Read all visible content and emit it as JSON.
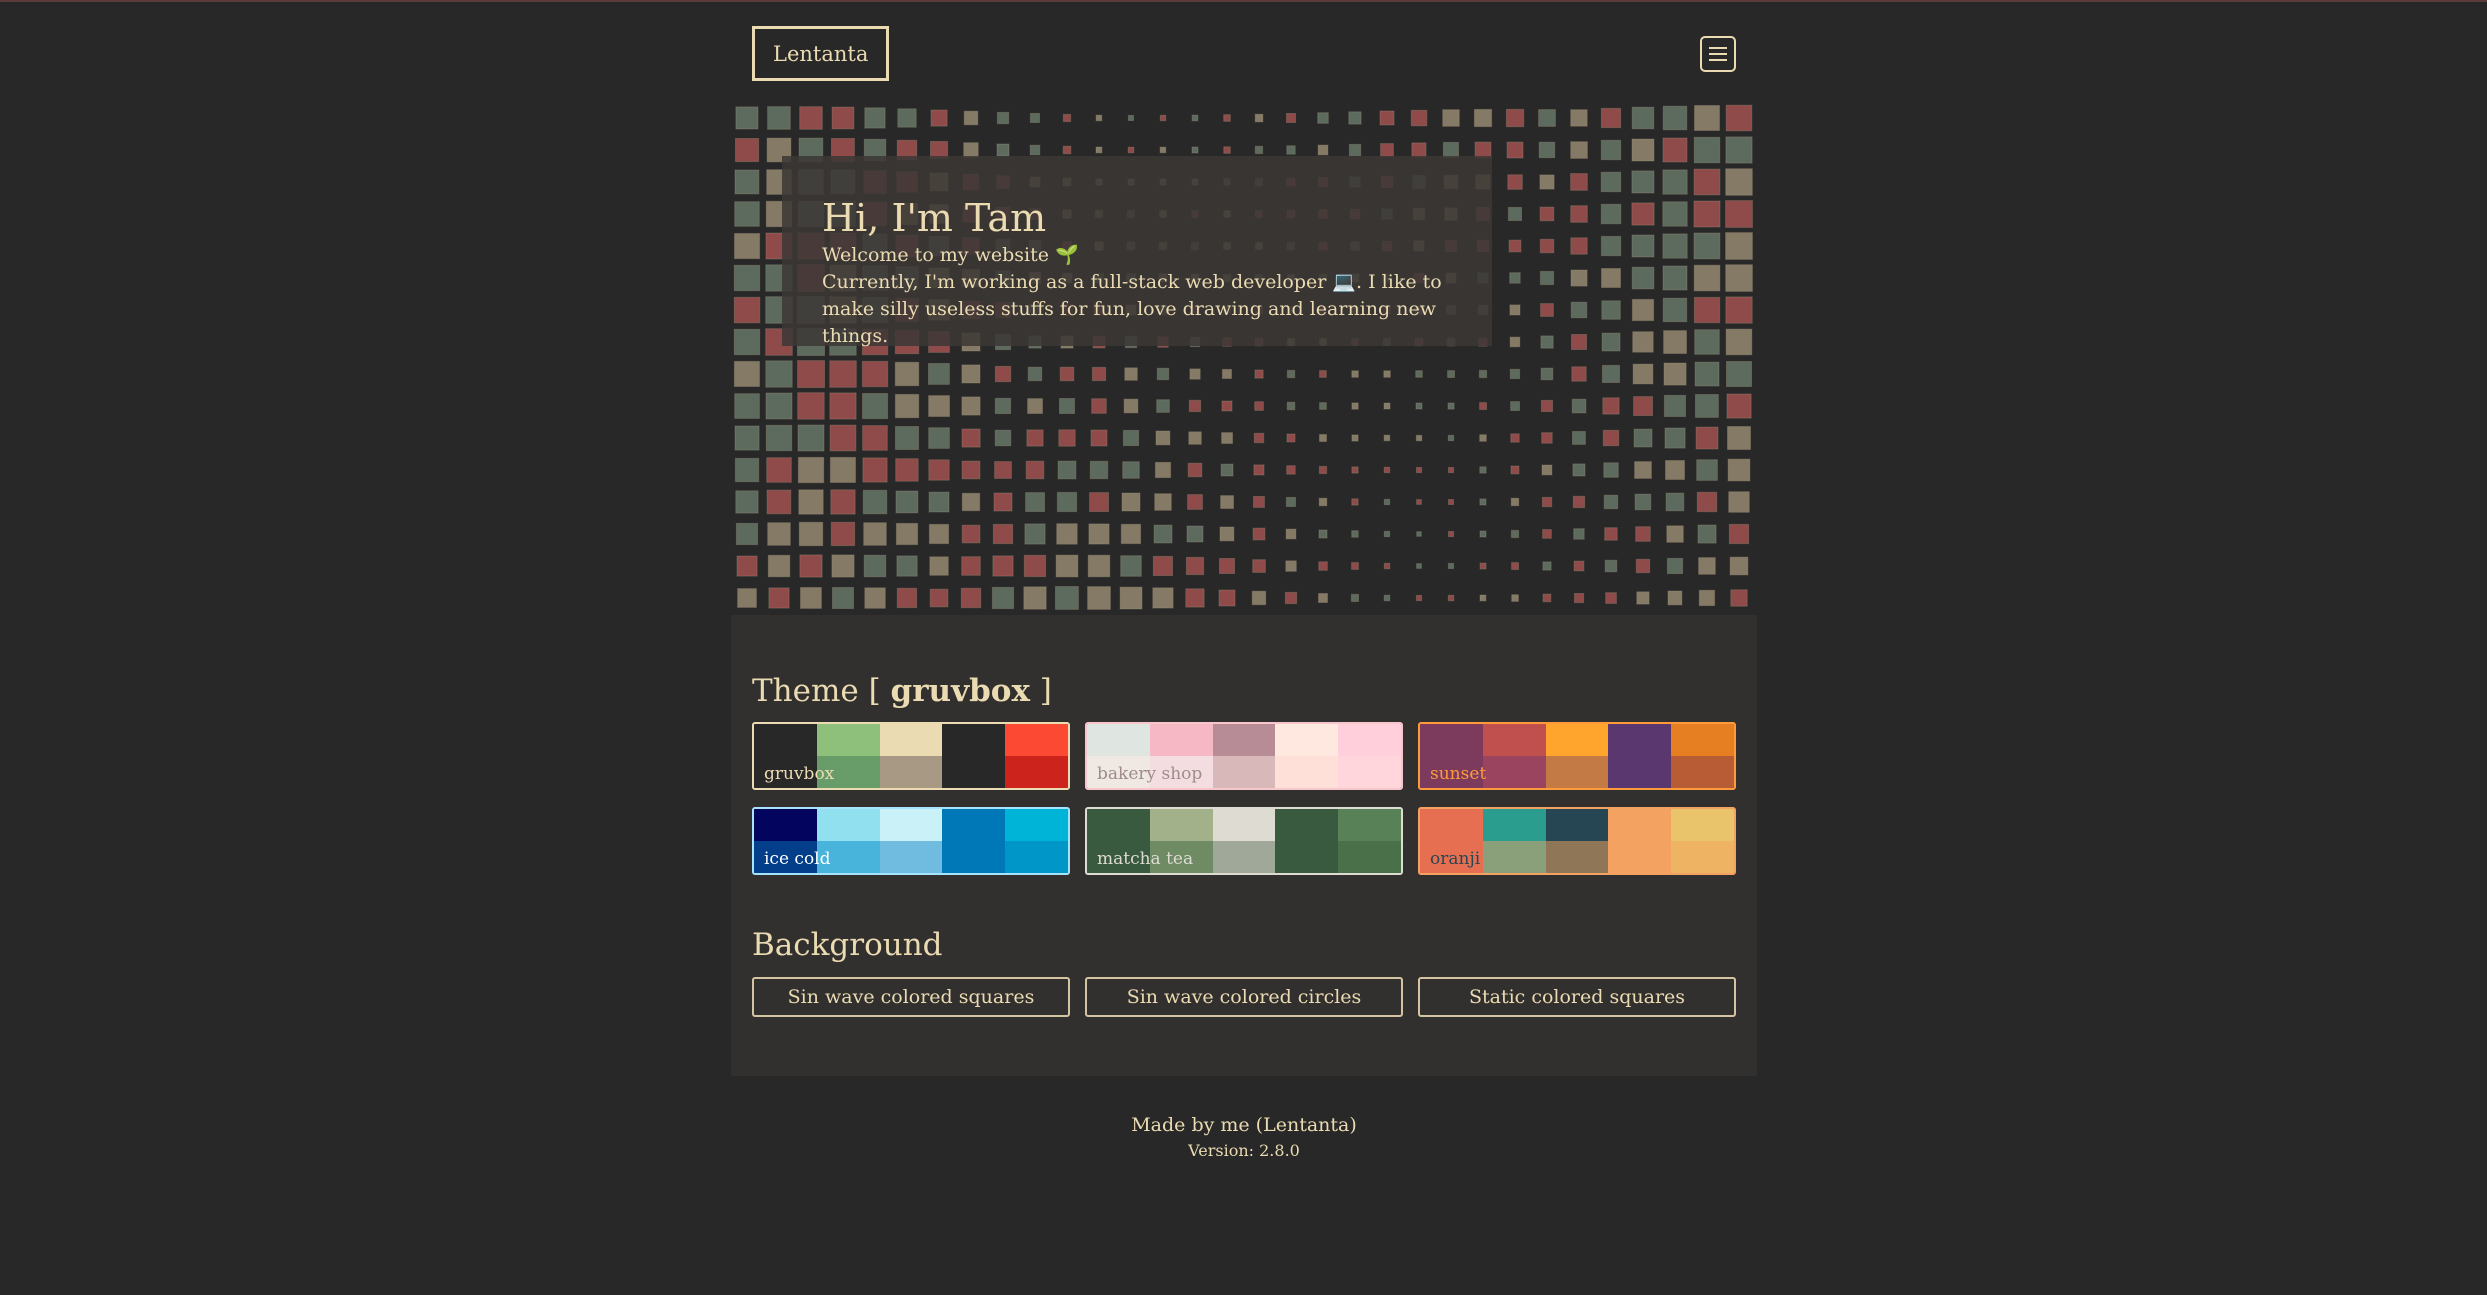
{
  "nav": {
    "logo": "Lentanta",
    "menu_icon": "hamburger-menu-icon"
  },
  "hero": {
    "title": "Hi, I'm Tam",
    "welcome": "Welcome to my website 🌱",
    "bio": "Currently, I'm working as a full-stack web developer 💻. I like to make silly useless stuffs for fun, love drawing and learning new things."
  },
  "theme": {
    "heading_prefix": "Theme [ ",
    "current": "gruvbox",
    "heading_suffix": " ]",
    "swatches": [
      {
        "name": "gruvbox",
        "label_color": "#ebdbb2",
        "border": "#ebdbb2",
        "top": [
          "#282828",
          "#8ec07c",
          "#ebdbb2",
          "#282828",
          "#fb4934"
        ],
        "bottom": [
          "#282828",
          "#689d6a",
          "#a89984",
          "#282828",
          "#cc241d"
        ]
      },
      {
        "name": "bakery shop",
        "label_color": "#9e8d8a",
        "border": "#f7c5cc",
        "top": [
          "#dfe5e0",
          "#f5b8c4",
          "#b88c96",
          "#ffe8e0",
          "#ffcfdc"
        ],
        "bottom": [
          "#f0e8e3",
          "#f3dde0",
          "#d8b8b8",
          "#ffe0d8",
          "#ffd6dc"
        ]
      },
      {
        "name": "sunset",
        "label_color": "#ff9a3c",
        "border": "#ff9a3c",
        "top": [
          "#7c3b5c",
          "#c0504d",
          "#ffa42c",
          "#5b3770",
          "#e67e22"
        ],
        "bottom": [
          "#7c3b5c",
          "#9a4460",
          "#c47a45",
          "#5b3770",
          "#b85c35"
        ]
      },
      {
        "name": "ice cold",
        "label_color": "#ffffff",
        "border": "#a6e3ff",
        "top": [
          "#03045e",
          "#90e0ef",
          "#caf0f8",
          "#0077b6",
          "#00b4d8"
        ],
        "bottom": [
          "#023e8a",
          "#48b4dc",
          "#6fbce0",
          "#0077b6",
          "#0096c7"
        ]
      },
      {
        "name": "matcha tea",
        "label_color": "#dedbd2",
        "border": "#dedbd2",
        "top": [
          "#3a5a40",
          "#a3b18a",
          "#dedbd2",
          "#3a5a40",
          "#588157"
        ],
        "bottom": [
          "#3a5a40",
          "#6e8b64",
          "#a0a89a",
          "#3a5a40",
          "#4a7049"
        ]
      },
      {
        "name": "oranji",
        "label_color": "#264653",
        "border": "#f4a261",
        "top": [
          "#e76f51",
          "#2a9d8f",
          "#264653",
          "#f4a261",
          "#e9c46a"
        ],
        "bottom": [
          "#e76f51",
          "#8aa07a",
          "#8f7657",
          "#f4a261",
          "#eeb464"
        ]
      }
    ]
  },
  "background": {
    "heading": "Background",
    "options": [
      "Sin wave colored squares",
      "Sin wave colored circles",
      "Static colored squares"
    ]
  },
  "footer": {
    "made_by": "Made by me (Lentanta)",
    "version": "Version: 2.8.0"
  },
  "colors": {
    "page_bg": "#282828",
    "panel_bg": "#32302f",
    "text": "#ebdbb2",
    "square_palette": [
      "#8f4a4a",
      "#5c6b5e",
      "#857a65"
    ]
  }
}
